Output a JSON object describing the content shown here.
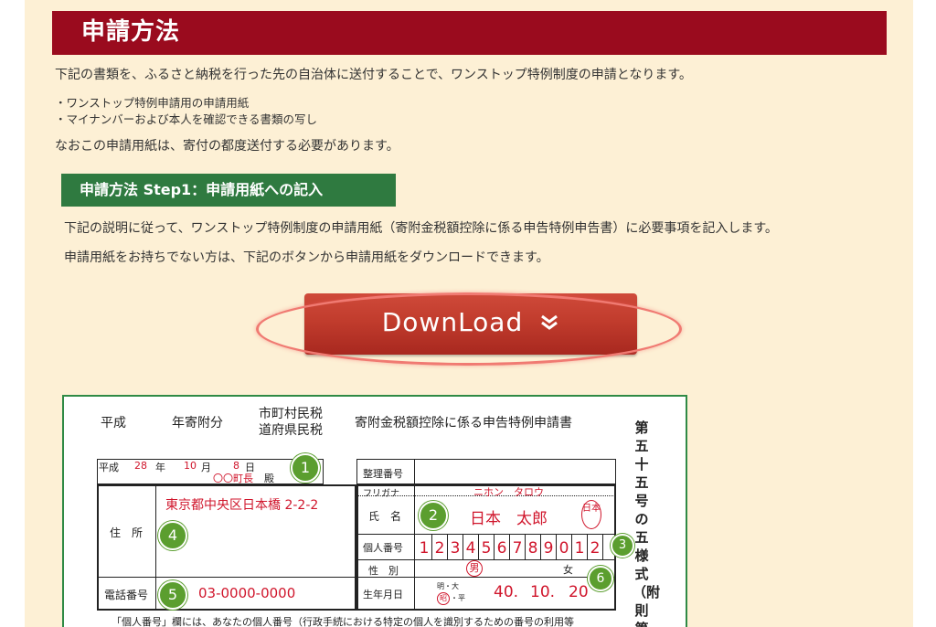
{
  "section": {
    "title": "申請方法",
    "intro": "下記の書類を、ふるさと納税を行った先の自治体に送付することで、ワンストップ特例制度の申請となります。",
    "documents": [
      "・ワンストップ特例申請用の申請用紙",
      "・マイナンバーおよび本人を確認できる書類の写し"
    ],
    "note": "なおこの申請用紙は、寄付の都度送付する必要があります。"
  },
  "step1": {
    "title": "申請方法 Step1：申請用紙への記入",
    "desc1": "下記の説明に従って、ワンストップ特例制度の申請用紙（寄附金税額控除に係る申告特例申告書）に必要事項を記入します。",
    "desc2": "申請用紙をお持ちでない方は、下記のボタンから申請用紙をダウンロードできます。"
  },
  "download": {
    "label": "DownLoad",
    "icon": "double-chevron-down-icon"
  },
  "form": {
    "header": {
      "era": "平成",
      "year_label": "年寄附分",
      "tax1": "市町村民税",
      "tax2": "道府県民税",
      "title": "寄附金税額控除に係る申告特例申請書"
    },
    "side_title": "第五十五号の五様式（附則第",
    "date": {
      "era": "平成",
      "year": "28",
      "year_unit": "年",
      "month": "10",
      "month_unit": "月",
      "day": "8",
      "day_unit": "日"
    },
    "addressee": "〇〇町長",
    "addressee_suffix": "殿",
    "labels": {
      "seiri": "整理番号",
      "furigana": "フリガナ",
      "name": "氏　名",
      "kojin": "個人番号",
      "seibetsu": "性　別",
      "birth": "生年月日",
      "address": "住　所",
      "phone": "電話番号"
    },
    "values": {
      "address": "東京都中央区日本橋 2-2-2",
      "furigana": "ニホン　タロウ",
      "name": "日本　太郎",
      "seal": "日本",
      "number": [
        "1",
        "2",
        "3",
        "4",
        "5",
        "6",
        "7",
        "8",
        "9",
        "0",
        "1",
        "2"
      ],
      "male": "男",
      "female": "女",
      "era_options_top": "明・大",
      "era_selected": "昭",
      "era_options_bottom": "・平",
      "birth_year": "40.",
      "birth_month": "10.",
      "birth_day": "20",
      "phone": "03-0000-0000"
    },
    "badges": [
      "1",
      "2",
      "3",
      "4",
      "5",
      "6"
    ],
    "footer": "「個人番号」欄には、あなたの個人番号（行政手続における特定の個人を識別するための番号の利用等"
  },
  "colors": {
    "header_red": "#9a0b1e",
    "step_green": "#2f7a40",
    "button_red": "#c13c2d",
    "badge_green": "#5b9e2f",
    "entry_red": "#d0162c"
  }
}
